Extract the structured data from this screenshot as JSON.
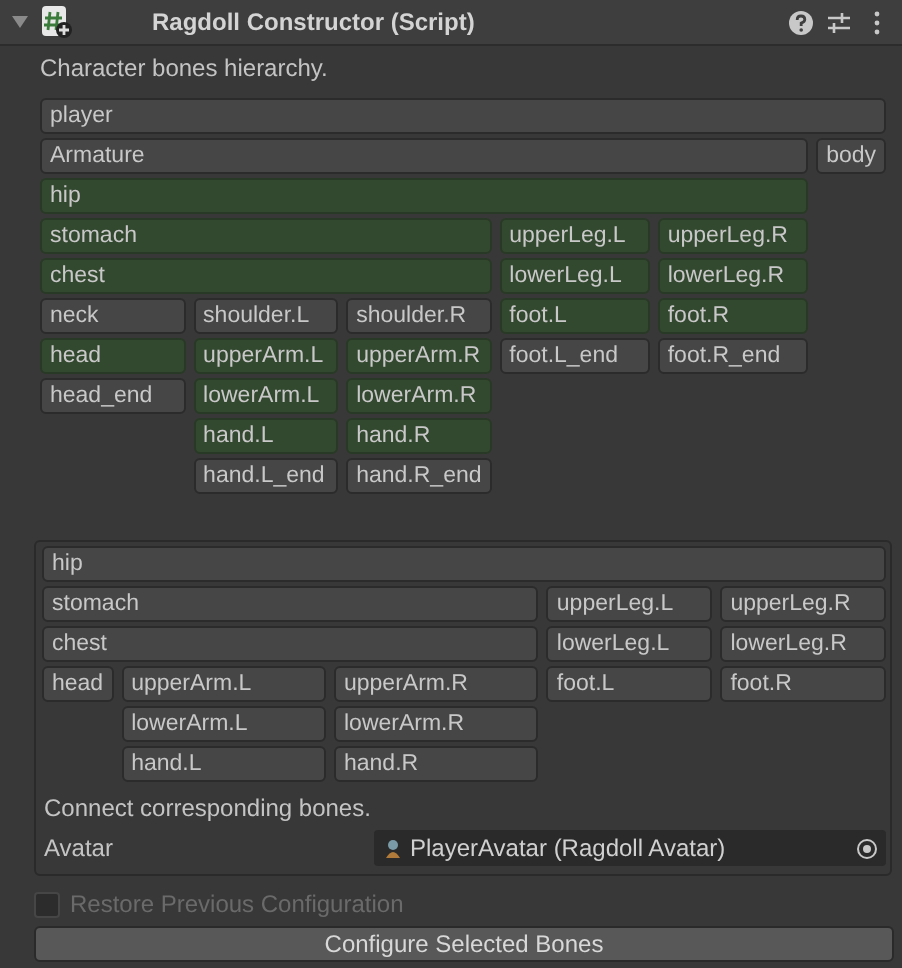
{
  "component": {
    "title": "Ragdoll Constructor (Script)",
    "expanded": true
  },
  "hierarchy": {
    "label": "Character bones hierarchy.",
    "bones": [
      {
        "name": "player",
        "selected": false,
        "children": [
          {
            "name": "Armature",
            "selected": false,
            "children": [
              {
                "name": "hip",
                "selected": true,
                "children": [
                  {
                    "name": "stomach",
                    "selected": true,
                    "children": [
                      {
                        "name": "chest",
                        "selected": true,
                        "children": [
                          {
                            "name": "neck",
                            "selected": false,
                            "children": [
                              {
                                "name": "head",
                                "selected": true,
                                "children": [
                                  {
                                    "name": "head_end",
                                    "selected": false
                                  }
                                ]
                              }
                            ]
                          },
                          {
                            "name": "shoulder.L",
                            "selected": false,
                            "children": [
                              {
                                "name": "upperArm.L",
                                "selected": true,
                                "children": [
                                  {
                                    "name": "lowerArm.L",
                                    "selected": true,
                                    "children": [
                                      {
                                        "name": "hand.L",
                                        "selected": true,
                                        "children": [
                                          {
                                            "name": "hand.L_end",
                                            "selected": false
                                          }
                                        ]
                                      }
                                    ]
                                  }
                                ]
                              }
                            ]
                          },
                          {
                            "name": "shoulder.R",
                            "selected": false,
                            "children": [
                              {
                                "name": "upperArm.R",
                                "selected": true,
                                "children": [
                                  {
                                    "name": "lowerArm.R",
                                    "selected": true,
                                    "children": [
                                      {
                                        "name": "hand.R",
                                        "selected": true,
                                        "children": [
                                          {
                                            "name": "hand.R_end",
                                            "selected": false
                                          }
                                        ]
                                      }
                                    ]
                                  }
                                ]
                              }
                            ]
                          }
                        ]
                      }
                    ]
                  },
                  {
                    "name": "upperLeg.L",
                    "selected": true,
                    "children": [
                      {
                        "name": "lowerLeg.L",
                        "selected": true,
                        "children": [
                          {
                            "name": "foot.L",
                            "selected": true,
                            "children": [
                              {
                                "name": "foot.L_end",
                                "selected": false
                              }
                            ]
                          }
                        ]
                      }
                    ]
                  },
                  {
                    "name": "upperLeg.R",
                    "selected": true,
                    "children": [
                      {
                        "name": "lowerLeg.R",
                        "selected": true,
                        "children": [
                          {
                            "name": "foot.R",
                            "selected": true,
                            "children": [
                              {
                                "name": "foot.R_end",
                                "selected": false
                              }
                            ]
                          }
                        ]
                      }
                    ]
                  }
                ]
              }
            ]
          },
          {
            "name": "body",
            "selected": false
          }
        ]
      }
    ]
  },
  "mapping": {
    "bones": [
      {
        "name": "hip",
        "selected": false,
        "children": [
          {
            "name": "stomach",
            "selected": false,
            "children": [
              {
                "name": "chest",
                "selected": false,
                "children": [
                  {
                    "name": "head",
                    "selected": false
                  },
                  {
                    "name": "upperArm.L",
                    "selected": false,
                    "children": [
                      {
                        "name": "lowerArm.L",
                        "selected": false,
                        "children": [
                          {
                            "name": "hand.L",
                            "selected": false
                          }
                        ]
                      }
                    ]
                  },
                  {
                    "name": "upperArm.R",
                    "selected": false,
                    "children": [
                      {
                        "name": "lowerArm.R",
                        "selected": false,
                        "children": [
                          {
                            "name": "hand.R",
                            "selected": false
                          }
                        ]
                      }
                    ]
                  }
                ]
              }
            ]
          },
          {
            "name": "upperLeg.L",
            "selected": false,
            "children": [
              {
                "name": "lowerLeg.L",
                "selected": false,
                "children": [
                  {
                    "name": "foot.L",
                    "selected": false
                  }
                ]
              }
            ]
          },
          {
            "name": "upperLeg.R",
            "selected": false,
            "children": [
              {
                "name": "lowerLeg.R",
                "selected": false,
                "children": [
                  {
                    "name": "foot.R",
                    "selected": false
                  }
                ]
              }
            ]
          }
        ]
      }
    ],
    "caption": "Connect corresponding bones.",
    "avatar": {
      "label": "Avatar",
      "value": "PlayerAvatar (Ragdoll Avatar)"
    }
  },
  "restore": {
    "label": "Restore Previous Configuration",
    "checked": false,
    "disabled": true
  },
  "button": "Configure Selected Bones"
}
